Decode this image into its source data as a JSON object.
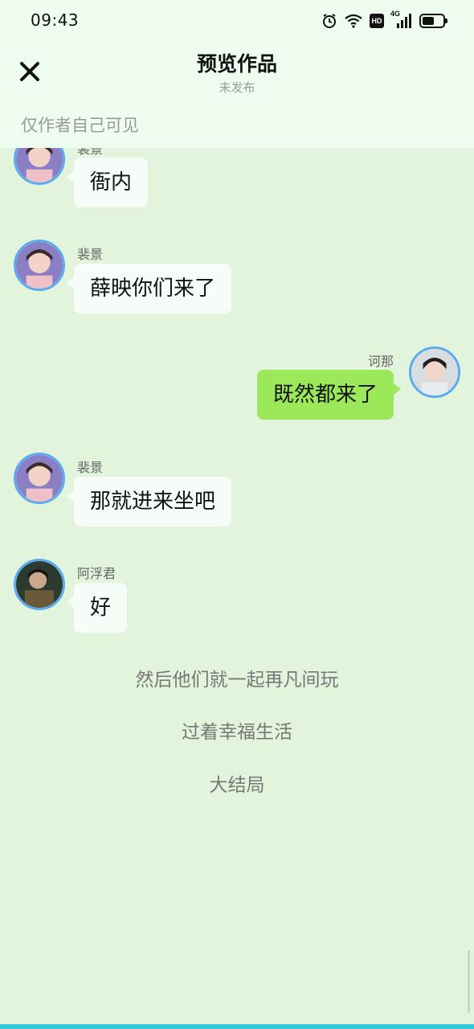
{
  "status_bar": {
    "time": "09:43",
    "icons": [
      "alarm-icon",
      "wifi-icon",
      "hd-icon",
      "signal-4g-icon",
      "battery-icon"
    ],
    "hd_label": "HD",
    "network_label": "4G",
    "battery_level": 0.6
  },
  "header": {
    "close_icon": "close-icon",
    "title": "预览作品",
    "subtitle": "未发布",
    "visibility_note": "仅作者自己可见"
  },
  "messages": [
    {
      "side": "left",
      "sender": "裴景",
      "text": "衙内",
      "avatar": "avatar-girl"
    },
    {
      "side": "left",
      "sender": "裴景",
      "text": "薛映你们来了",
      "avatar": "avatar-girl"
    },
    {
      "side": "right",
      "sender": "诃那",
      "text": "既然都来了",
      "avatar": "avatar-boy"
    },
    {
      "side": "left",
      "sender": "裴景",
      "text": "那就进来坐吧",
      "avatar": "avatar-girl"
    },
    {
      "side": "left",
      "sender": "阿浮君",
      "text": "好",
      "avatar": "avatar-warrior"
    }
  ],
  "narrations": [
    "然后他们就一起再凡间玩",
    "过着幸福生活",
    "大结局"
  ],
  "colors": {
    "background": "#e3f4dc",
    "header_bg": "#eefcf0",
    "bubble_left": "#f6fdf8",
    "bubble_right": "#9be85a",
    "avatar_border": "#5aacef",
    "bottom_accent": "#33c7d9"
  }
}
